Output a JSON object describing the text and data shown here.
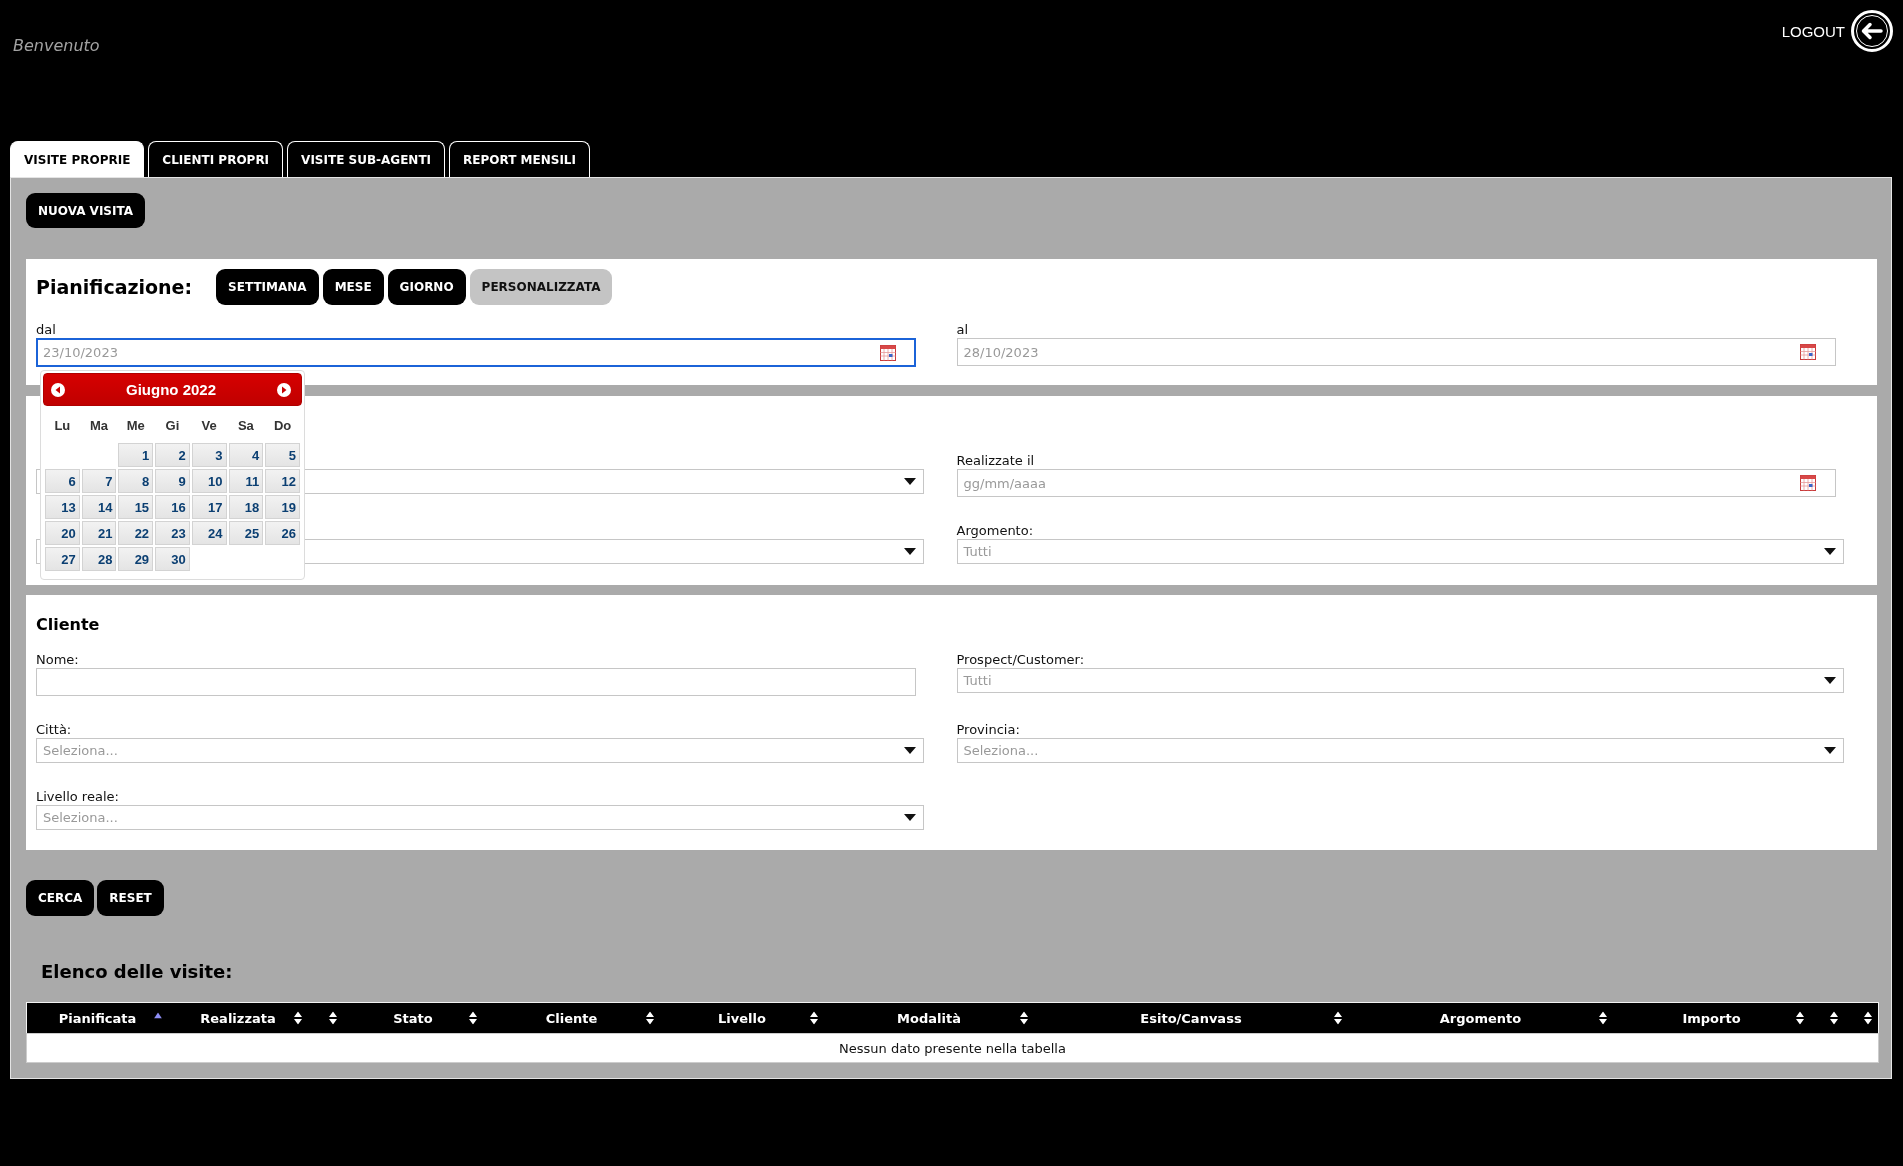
{
  "header": {
    "greeting": "Benvenuto",
    "logout": "LOGOUT"
  },
  "tabs": [
    {
      "label": "VISITE PROPRIE",
      "selected": true
    },
    {
      "label": "CLIENTI PROPRI",
      "selected": false
    },
    {
      "label": "VISITE SUB-AGENTI",
      "selected": false
    },
    {
      "label": "REPORT MENSILI",
      "selected": false
    }
  ],
  "new_visit_button": "NUOVA VISITA",
  "planning": {
    "title": "Pianificazione:",
    "periods": [
      {
        "label": "SETTIMANA",
        "selected": false
      },
      {
        "label": "MESE",
        "selected": false
      },
      {
        "label": "GIORNO",
        "selected": false
      },
      {
        "label": "PERSONALIZZATA",
        "selected": true
      }
    ],
    "fields": [
      {
        "kind": "date",
        "label": "dal",
        "value": "23/10/2023",
        "focused": true
      },
      {
        "kind": "date",
        "label": "al",
        "value": "28/10/2023",
        "focused": false
      }
    ]
  },
  "date_picker": {
    "month": "Giugno 2022",
    "weekdays": [
      "Lu",
      "Ma",
      "Me",
      "Gi",
      "Ve",
      "Sa",
      "Do"
    ],
    "weeks": [
      [
        {
          "kind": "blank"
        },
        {
          "kind": "blank"
        },
        {
          "kind": "day",
          "label": "1"
        },
        {
          "kind": "day",
          "label": "2"
        },
        {
          "kind": "day",
          "label": "3"
        },
        {
          "kind": "day",
          "label": "4"
        },
        {
          "kind": "day",
          "label": "5"
        }
      ],
      [
        {
          "kind": "day",
          "label": "6"
        },
        {
          "kind": "day",
          "label": "7"
        },
        {
          "kind": "day",
          "label": "8"
        },
        {
          "kind": "day",
          "label": "9"
        },
        {
          "kind": "day",
          "label": "10"
        },
        {
          "kind": "day",
          "label": "11"
        },
        {
          "kind": "day",
          "label": "12"
        }
      ],
      [
        {
          "kind": "day",
          "label": "13"
        },
        {
          "kind": "day",
          "label": "14"
        },
        {
          "kind": "day",
          "label": "15"
        },
        {
          "kind": "day",
          "label": "16"
        },
        {
          "kind": "day",
          "label": "17"
        },
        {
          "kind": "day",
          "label": "18"
        },
        {
          "kind": "day",
          "label": "19"
        }
      ],
      [
        {
          "kind": "day",
          "label": "20"
        },
        {
          "kind": "day",
          "label": "21"
        },
        {
          "kind": "day",
          "label": "22"
        },
        {
          "kind": "day",
          "label": "23"
        },
        {
          "kind": "day",
          "label": "24"
        },
        {
          "kind": "day",
          "label": "25"
        },
        {
          "kind": "day",
          "label": "26"
        }
      ],
      [
        {
          "kind": "day",
          "label": "27"
        },
        {
          "kind": "day",
          "label": "28"
        },
        {
          "kind": "day",
          "label": "29"
        },
        {
          "kind": "day",
          "label": "30"
        }
      ]
    ]
  },
  "visit_filters": {
    "fields": [
      {
        "kind": "select"
      },
      {
        "kind": "date",
        "label": "Realizzate il",
        "placeholder": "gg/mm/aaaa"
      },
      {
        "kind": "select"
      },
      {
        "kind": "select",
        "label": "Argomento:",
        "value": "Tutti"
      }
    ]
  },
  "customer": {
    "title": "Cliente",
    "fields": [
      {
        "kind": "text",
        "label": "Nome:"
      },
      {
        "kind": "select",
        "label": "Prospect/Customer:",
        "value": "Tutti"
      },
      {
        "kind": "select",
        "label": "Città:",
        "placeholder": "Seleziona..."
      },
      {
        "kind": "select",
        "label": "Provincia:",
        "placeholder": "Seleziona..."
      },
      {
        "kind": "select",
        "label": "Livello reale:",
        "placeholder": "Seleziona..."
      }
    ]
  },
  "actions": [
    "CERCA",
    "RESET"
  ],
  "visits": {
    "title": "Elenco delle visite:",
    "columns": [
      {
        "label": "Pianificata",
        "sorted": true
      },
      {
        "label": "Realizzata",
        "sorted": false
      },
      {
        "sorted": false
      },
      {
        "label": "Stato",
        "sorted": false
      },
      {
        "label": "Cliente",
        "sorted": false
      },
      {
        "label": "Livello",
        "sorted": false
      },
      {
        "label": "Modalità",
        "sorted": false
      },
      {
        "label": "Esito/Canvass",
        "sorted": false
      },
      {
        "label": "Argomento",
        "sorted": false
      },
      {
        "label": "Importo",
        "sorted": false
      },
      {
        "sorted": false
      },
      {
        "sorted": false
      }
    ],
    "empty_message": "Nessun dato presente nella tabella"
  }
}
